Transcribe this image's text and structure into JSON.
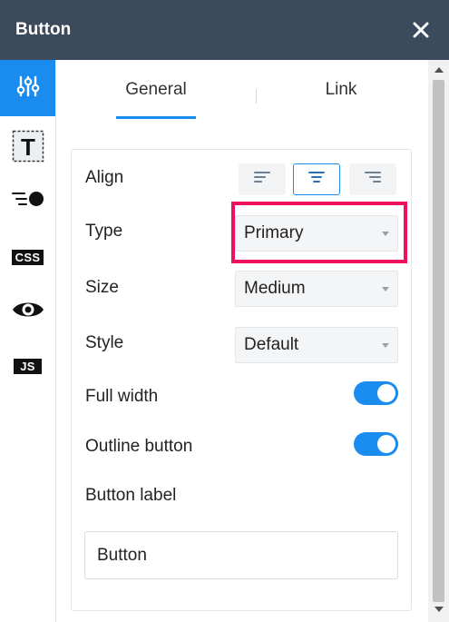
{
  "header": {
    "title": "Button"
  },
  "rail": {
    "css_badge": "CSS",
    "js_badge": "JS"
  },
  "tabs": [
    {
      "label": "General",
      "active": true
    },
    {
      "label": "Link",
      "active": false
    }
  ],
  "settings": {
    "align_label": "Align",
    "align_selected": "center",
    "type_label": "Type",
    "type_value": "Primary",
    "size_label": "Size",
    "size_value": "Medium",
    "style_label": "Style",
    "style_value": "Default",
    "full_width_label": "Full width",
    "full_width_on": true,
    "outline_label": "Outline button",
    "outline_on": true,
    "button_label_label": "Button label",
    "button_label_value": "Button"
  },
  "colors": {
    "header_bg": "#3c4a5e",
    "accent": "#1a8cf0",
    "highlight": "#ec1160"
  }
}
